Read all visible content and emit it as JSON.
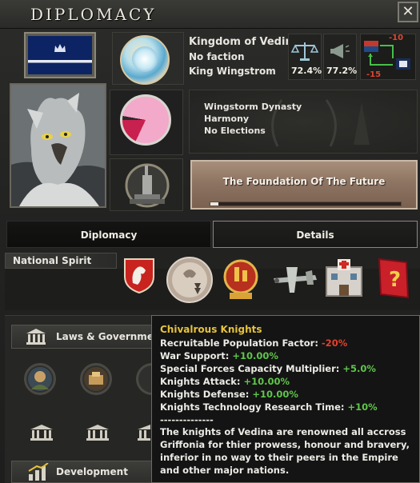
{
  "window": {
    "title": "Diplomacy",
    "close_label": "✕"
  },
  "country": {
    "name": "Kingdom of Vedina",
    "faction": "No faction",
    "leader_title": "King Wingstrom"
  },
  "stats": {
    "stability": "72.4%",
    "war_support": "77.2%",
    "relation_top": "-10",
    "relation_bottom": "-15"
  },
  "party": {
    "name": "Wingstorm Dynasty",
    "ideology": "Harmony",
    "elections": "No Elections",
    "pie_main_color": "#f3a9c9",
    "pie_slice_color": "#c8204f",
    "pie_dark_color": "#2a2a2a"
  },
  "focus": {
    "name": "The Foundation Of The Future",
    "progress": 0.04
  },
  "tabs": {
    "diplomacy": "Diplomacy",
    "details": "Details"
  },
  "national_spirit": {
    "label": "National Spirit",
    "icons": [
      "griffon-shield-icon",
      "knight-coin-icon",
      "industry-medal-icon",
      "aircraft-icon",
      "hospital-icon",
      "question-book-icon"
    ]
  },
  "laws": {
    "label": "Laws & Government",
    "development_label": "Development"
  },
  "tooltip": {
    "title": "Chivalrous Knights",
    "lines": [
      {
        "label": "Recruitable Population Factor: ",
        "value": "-20%",
        "tone": "neg"
      },
      {
        "label": "War Support: ",
        "value": "+10.00%",
        "tone": "pos"
      },
      {
        "label": "Special Forces Capacity Multiplier: ",
        "value": "+5.0%",
        "tone": "pos"
      },
      {
        "label": "Knights Attack: ",
        "value": "+10.00%",
        "tone": "pos"
      },
      {
        "label": "Knights Defense: ",
        "value": "+10.00%",
        "tone": "pos"
      },
      {
        "label": "Knights Technology Research Time: ",
        "value": "+10%",
        "tone": "pos"
      }
    ],
    "separator": "--------------",
    "description": "The knights of Vedina are renowned all accross Griffonia for thier prowess, honour and bravery, inferior in no way to their peers in the Empire and other major nations."
  },
  "colors": {
    "accent_gold": "#e7c33b",
    "positive": "#5fc64a",
    "negative": "#e2402c"
  }
}
